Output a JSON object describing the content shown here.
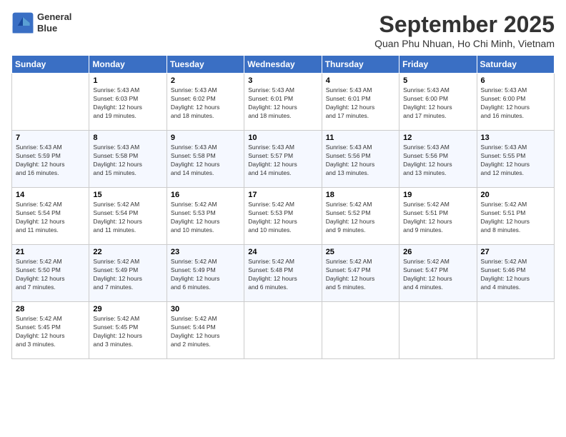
{
  "header": {
    "logo_line1": "General",
    "logo_line2": "Blue",
    "month": "September 2025",
    "location": "Quan Phu Nhuan, Ho Chi Minh, Vietnam"
  },
  "weekdays": [
    "Sunday",
    "Monday",
    "Tuesday",
    "Wednesday",
    "Thursday",
    "Friday",
    "Saturday"
  ],
  "weeks": [
    [
      {
        "day": "",
        "info": ""
      },
      {
        "day": "1",
        "info": "Sunrise: 5:43 AM\nSunset: 6:03 PM\nDaylight: 12 hours\nand 19 minutes."
      },
      {
        "day": "2",
        "info": "Sunrise: 5:43 AM\nSunset: 6:02 PM\nDaylight: 12 hours\nand 18 minutes."
      },
      {
        "day": "3",
        "info": "Sunrise: 5:43 AM\nSunset: 6:01 PM\nDaylight: 12 hours\nand 18 minutes."
      },
      {
        "day": "4",
        "info": "Sunrise: 5:43 AM\nSunset: 6:01 PM\nDaylight: 12 hours\nand 17 minutes."
      },
      {
        "day": "5",
        "info": "Sunrise: 5:43 AM\nSunset: 6:00 PM\nDaylight: 12 hours\nand 17 minutes."
      },
      {
        "day": "6",
        "info": "Sunrise: 5:43 AM\nSunset: 6:00 PM\nDaylight: 12 hours\nand 16 minutes."
      }
    ],
    [
      {
        "day": "7",
        "info": "Sunrise: 5:43 AM\nSunset: 5:59 PM\nDaylight: 12 hours\nand 16 minutes."
      },
      {
        "day": "8",
        "info": "Sunrise: 5:43 AM\nSunset: 5:58 PM\nDaylight: 12 hours\nand 15 minutes."
      },
      {
        "day": "9",
        "info": "Sunrise: 5:43 AM\nSunset: 5:58 PM\nDaylight: 12 hours\nand 14 minutes."
      },
      {
        "day": "10",
        "info": "Sunrise: 5:43 AM\nSunset: 5:57 PM\nDaylight: 12 hours\nand 14 minutes."
      },
      {
        "day": "11",
        "info": "Sunrise: 5:43 AM\nSunset: 5:56 PM\nDaylight: 12 hours\nand 13 minutes."
      },
      {
        "day": "12",
        "info": "Sunrise: 5:43 AM\nSunset: 5:56 PM\nDaylight: 12 hours\nand 13 minutes."
      },
      {
        "day": "13",
        "info": "Sunrise: 5:43 AM\nSunset: 5:55 PM\nDaylight: 12 hours\nand 12 minutes."
      }
    ],
    [
      {
        "day": "14",
        "info": "Sunrise: 5:42 AM\nSunset: 5:54 PM\nDaylight: 12 hours\nand 11 minutes."
      },
      {
        "day": "15",
        "info": "Sunrise: 5:42 AM\nSunset: 5:54 PM\nDaylight: 12 hours\nand 11 minutes."
      },
      {
        "day": "16",
        "info": "Sunrise: 5:42 AM\nSunset: 5:53 PM\nDaylight: 12 hours\nand 10 minutes."
      },
      {
        "day": "17",
        "info": "Sunrise: 5:42 AM\nSunset: 5:53 PM\nDaylight: 12 hours\nand 10 minutes."
      },
      {
        "day": "18",
        "info": "Sunrise: 5:42 AM\nSunset: 5:52 PM\nDaylight: 12 hours\nand 9 minutes."
      },
      {
        "day": "19",
        "info": "Sunrise: 5:42 AM\nSunset: 5:51 PM\nDaylight: 12 hours\nand 9 minutes."
      },
      {
        "day": "20",
        "info": "Sunrise: 5:42 AM\nSunset: 5:51 PM\nDaylight: 12 hours\nand 8 minutes."
      }
    ],
    [
      {
        "day": "21",
        "info": "Sunrise: 5:42 AM\nSunset: 5:50 PM\nDaylight: 12 hours\nand 7 minutes."
      },
      {
        "day": "22",
        "info": "Sunrise: 5:42 AM\nSunset: 5:49 PM\nDaylight: 12 hours\nand 7 minutes."
      },
      {
        "day": "23",
        "info": "Sunrise: 5:42 AM\nSunset: 5:49 PM\nDaylight: 12 hours\nand 6 minutes."
      },
      {
        "day": "24",
        "info": "Sunrise: 5:42 AM\nSunset: 5:48 PM\nDaylight: 12 hours\nand 6 minutes."
      },
      {
        "day": "25",
        "info": "Sunrise: 5:42 AM\nSunset: 5:47 PM\nDaylight: 12 hours\nand 5 minutes."
      },
      {
        "day": "26",
        "info": "Sunrise: 5:42 AM\nSunset: 5:47 PM\nDaylight: 12 hours\nand 4 minutes."
      },
      {
        "day": "27",
        "info": "Sunrise: 5:42 AM\nSunset: 5:46 PM\nDaylight: 12 hours\nand 4 minutes."
      }
    ],
    [
      {
        "day": "28",
        "info": "Sunrise: 5:42 AM\nSunset: 5:45 PM\nDaylight: 12 hours\nand 3 minutes."
      },
      {
        "day": "29",
        "info": "Sunrise: 5:42 AM\nSunset: 5:45 PM\nDaylight: 12 hours\nand 3 minutes."
      },
      {
        "day": "30",
        "info": "Sunrise: 5:42 AM\nSunset: 5:44 PM\nDaylight: 12 hours\nand 2 minutes."
      },
      {
        "day": "",
        "info": ""
      },
      {
        "day": "",
        "info": ""
      },
      {
        "day": "",
        "info": ""
      },
      {
        "day": "",
        "info": ""
      }
    ]
  ]
}
